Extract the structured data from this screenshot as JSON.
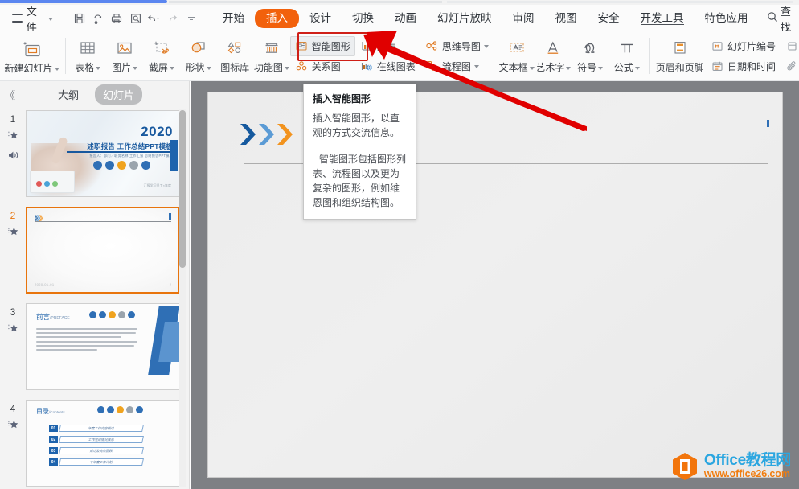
{
  "menubar": {
    "file_label": "文件",
    "quick_icons": [
      "save-icon",
      "cloud-sync-icon",
      "print-icon",
      "print-preview-icon",
      "undo-icon",
      "redo-icon",
      "customize-toolbar-icon"
    ],
    "tabs": [
      {
        "label": "开始",
        "state": "normal"
      },
      {
        "label": "插入",
        "state": "active"
      },
      {
        "label": "设计",
        "state": "normal"
      },
      {
        "label": "切换",
        "state": "underline"
      },
      {
        "label": "动画",
        "state": "normal"
      },
      {
        "label": "幻灯片放映",
        "state": "normal"
      },
      {
        "label": "审阅",
        "state": "normal"
      },
      {
        "label": "视图",
        "state": "normal"
      },
      {
        "label": "安全",
        "state": "normal"
      },
      {
        "label": "开发工具",
        "state": "hyperlink"
      },
      {
        "label": "特色应用",
        "state": "normal"
      }
    ],
    "search_label": "查找"
  },
  "ribbon": {
    "new_slide": {
      "label": "新建幻灯片",
      "icon": "new-slide-icon"
    },
    "items": [
      {
        "label": "表格",
        "icon": "table-icon",
        "caret": true
      },
      {
        "label": "图片",
        "icon": "picture-icon",
        "caret": true
      },
      {
        "label": "截屏",
        "icon": "screenshot-icon",
        "caret": true
      },
      {
        "label": "形状",
        "icon": "shapes-icon",
        "caret": true
      },
      {
        "label": "图标库",
        "icon": "icon-library-icon",
        "caret": false
      },
      {
        "label": "功能图",
        "icon": "function-chart-icon",
        "caret": true
      }
    ],
    "stacked": [
      {
        "rows": [
          {
            "label": "智能图形",
            "icon": "smartart-icon",
            "caret": false,
            "highlighted": true
          },
          {
            "label": "关系图",
            "icon": "relation-diagram-icon",
            "caret": false,
            "highlighted": false
          }
        ]
      },
      {
        "rows": [
          {
            "label": "图表",
            "icon": "chart-icon",
            "caret": false,
            "highlighted": false
          },
          {
            "label": "在线图表",
            "icon": "online-chart-icon",
            "caret": false,
            "highlighted": false
          }
        ]
      },
      {
        "rows": [
          {
            "label": "思维导图",
            "icon": "mindmap-icon",
            "caret": true,
            "highlighted": false
          },
          {
            "label": "流程图",
            "icon": "flowchart-icon",
            "caret": true,
            "highlighted": false
          }
        ]
      }
    ],
    "text_group": [
      {
        "label": "文本框",
        "icon": "textbox-icon",
        "caret": true
      },
      {
        "label": "艺术字",
        "icon": "wordart-icon",
        "caret": true
      },
      {
        "label": "符号",
        "icon": "symbol-icon",
        "caret": true
      },
      {
        "label": "公式",
        "icon": "formula-icon",
        "caret": true
      }
    ],
    "header_footer": {
      "label": "页眉和页脚",
      "icon": "header-footer-icon"
    },
    "right_stacked": [
      {
        "label": "幻灯片编号",
        "icon": "slide-number-icon"
      },
      {
        "label": "日期和时间",
        "icon": "date-time-icon"
      }
    ],
    "edge_icons": [
      "object-icon",
      "attachment-icon"
    ]
  },
  "tooltip": {
    "title": "插入智能图形",
    "paragraph1": "插入智能图形，以直观的方式交流信息。",
    "paragraph2": "智能图形包括图形列表、流程图以及更为复杂的图形，例如维恩图和组织结构图。"
  },
  "left_panel": {
    "collapse_label": "《",
    "tabs": [
      {
        "label": "大纲",
        "active": false
      },
      {
        "label": "幻灯片",
        "active": true
      }
    ],
    "slides": [
      {
        "number": "1",
        "selected": false,
        "icons": [
          "animation-star-icon",
          "audio-speaker-icon"
        ],
        "year": "2020",
        "title": "述职报告 工作总结PPT模板",
        "subtitle": "报告人：部门／职务名称  工作汇报  总结报告PPT模板",
        "footer": "汇报学习员工×年度"
      },
      {
        "number": "2",
        "selected": true,
        "icons": [
          "animation-star-icon"
        ],
        "chevron": "》》",
        "stamp": "2020-01-01",
        "page": "2"
      },
      {
        "number": "3",
        "selected": false,
        "icons": [
          "animation-star-icon"
        ],
        "heading": "前言",
        "heading_en": "/PREFACE"
      },
      {
        "number": "4",
        "selected": false,
        "icons": [
          "animation-star-icon"
        ],
        "heading": "目录",
        "heading_en": "/Contents",
        "contents": [
          {
            "num": "01",
            "text": "年度工作内容概述"
          },
          {
            "num": "02",
            "text": "工作完成情况展示"
          },
          {
            "num": "03",
            "text": "成功及亮点回顾"
          },
          {
            "num": "04",
            "text": "下年度工作计划"
          }
        ]
      }
    ]
  },
  "canvas": {
    "slide_chevrons": [
      "dark-blue-chevron",
      "light-blue-chevron",
      "orange-chevron"
    ]
  },
  "watermark": {
    "name": "Office教程网",
    "url": "www.office26.com",
    "logo": "office-tutorial-logo"
  },
  "colors": {
    "accent_orange": "#f2610c",
    "tab_underline_red": "#c8261c",
    "selection_orange": "#e8740c",
    "arrow_red": "#e00000",
    "chevron_dark_blue": "#15599e",
    "chevron_light_blue": "#5b9bd5",
    "chevron_orange": "#f2931e",
    "watermark_blue": "#2ba6e0",
    "watermark_orange": "#f07d10",
    "panel_bg": "#f3f3f3",
    "canvas_bg": "#7e8084"
  }
}
